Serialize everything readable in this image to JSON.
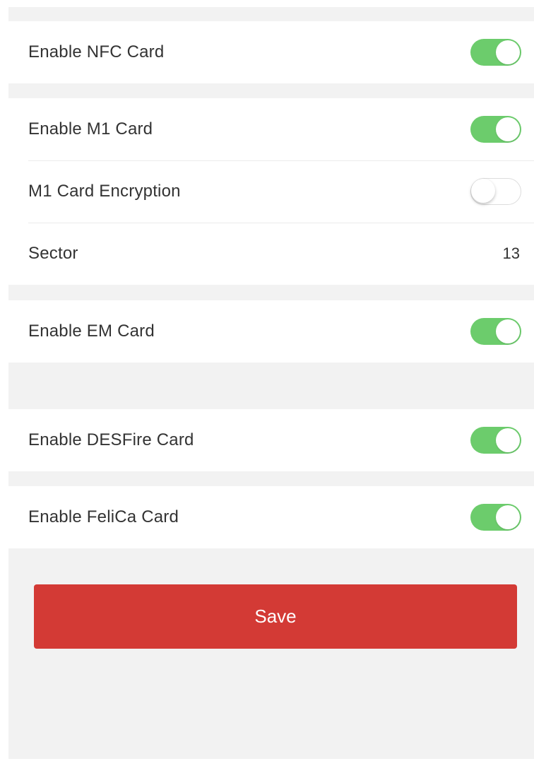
{
  "colors": {
    "toggle_on": "#6ccc6c",
    "save_button": "#d33a35",
    "background": "#f2f2f2"
  },
  "settings": {
    "nfc": {
      "label": "Enable NFC Card",
      "enabled": true
    },
    "m1": {
      "label": "Enable M1 Card",
      "enabled": true
    },
    "m1_encryption": {
      "label": "M1 Card Encryption",
      "enabled": false
    },
    "sector": {
      "label": "Sector",
      "value": "13"
    },
    "em": {
      "label": "Enable EM Card",
      "enabled": true
    },
    "desfire": {
      "label": "Enable DESFire Card",
      "enabled": true
    },
    "felica": {
      "label": "Enable FeliCa Card",
      "enabled": true
    }
  },
  "actions": {
    "save_label": "Save"
  }
}
